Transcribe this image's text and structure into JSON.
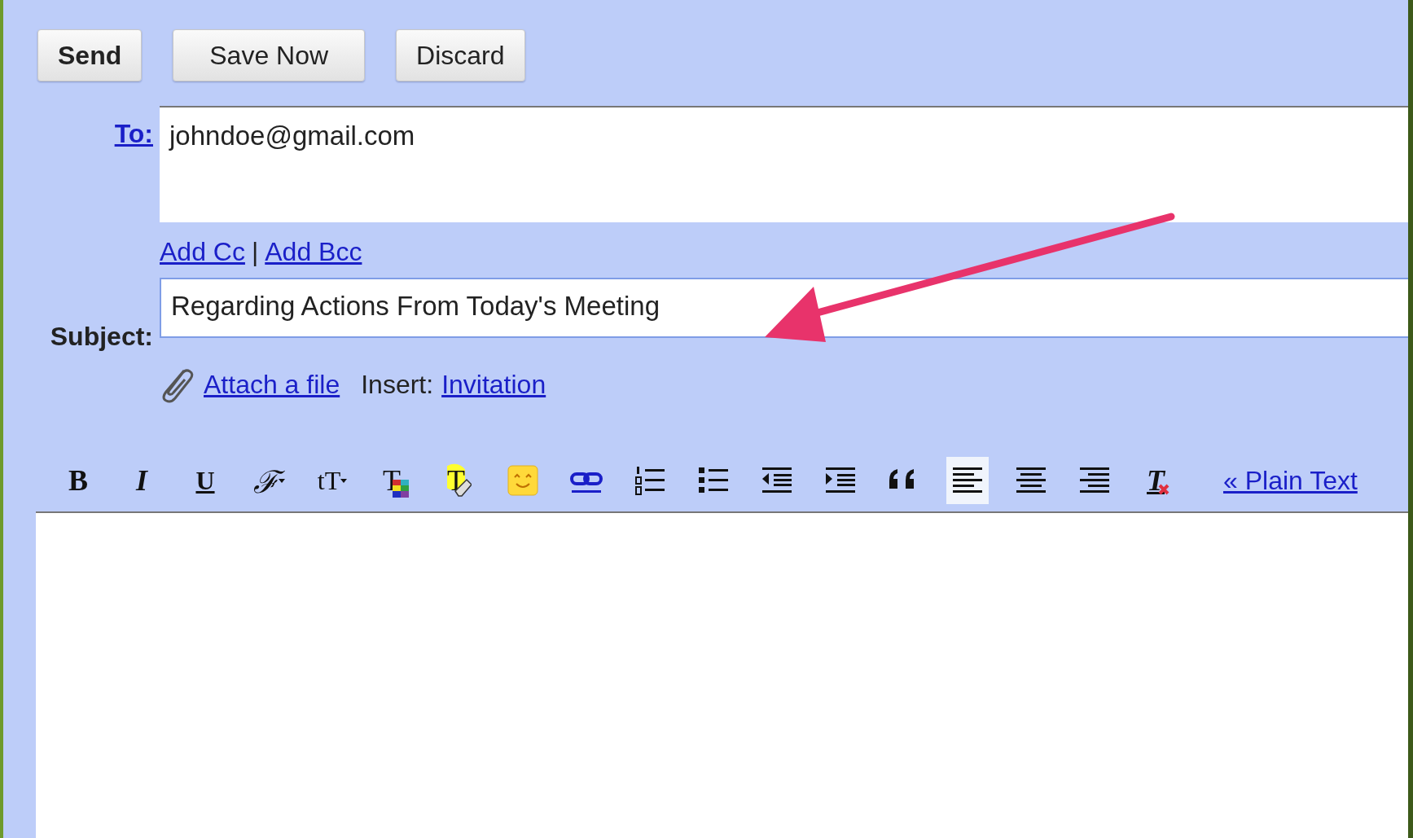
{
  "buttons": [
    {
      "label": "Send",
      "kind": "primary"
    },
    {
      "label": "Save Now",
      "kind": "normal"
    },
    {
      "label": "Discard",
      "kind": "normal"
    }
  ],
  "to": {
    "label": "To:",
    "value": "johndoe@gmail.com"
  },
  "cc_links": [
    "Add Cc",
    "Add Bcc"
  ],
  "cc_separator": "|",
  "subject": {
    "label": "Subject:",
    "value": "Regarding Actions From Today's Meeting"
  },
  "attach": {
    "link": "Attach a file",
    "insert_label": "Insert:",
    "insert_link": "Invitation"
  },
  "toolbar": [
    {
      "kind": "bold",
      "glyph": "B",
      "selected": false
    },
    {
      "kind": "italic",
      "glyph": "I",
      "selected": false
    },
    {
      "kind": "underline",
      "glyph": "U",
      "selected": false
    },
    {
      "kind": "font",
      "glyph": "ℱ",
      "selected": false
    },
    {
      "kind": "size",
      "glyph": "tT",
      "selected": false
    },
    {
      "kind": "text-color",
      "glyph": "T",
      "selected": false
    },
    {
      "kind": "highlight",
      "glyph": "T",
      "selected": false
    },
    {
      "kind": "emoji",
      "selected": false
    },
    {
      "kind": "link",
      "selected": false
    },
    {
      "kind": "numbered-list",
      "selected": false
    },
    {
      "kind": "bullet-list",
      "selected": false
    },
    {
      "kind": "outdent",
      "selected": false
    },
    {
      "kind": "indent",
      "selected": false
    },
    {
      "kind": "quote",
      "selected": false
    },
    {
      "kind": "align-left",
      "selected": true
    },
    {
      "kind": "align-center",
      "selected": false
    },
    {
      "kind": "align-right",
      "selected": false
    },
    {
      "kind": "remove-format",
      "glyph": "T",
      "selected": false
    }
  ],
  "plain_text_link": "« Plain Text"
}
